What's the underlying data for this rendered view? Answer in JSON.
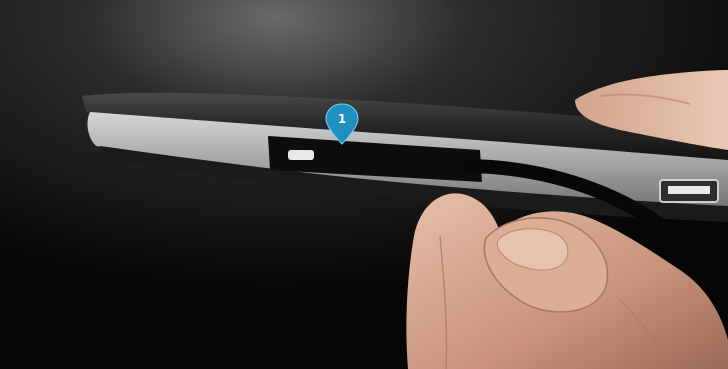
{
  "photo": {
    "subject": "tablet-in-folio-case-side-view",
    "background_color": "#0c0c0c",
    "case_color": "#2a2a2a",
    "device_edge_color": "#b8b8b8",
    "skin_color": "#d8a890",
    "cable_color": "#0a0a0a"
  },
  "callout": {
    "number": "1",
    "color": "#1e8fbf",
    "icon": "location-pin-icon"
  }
}
